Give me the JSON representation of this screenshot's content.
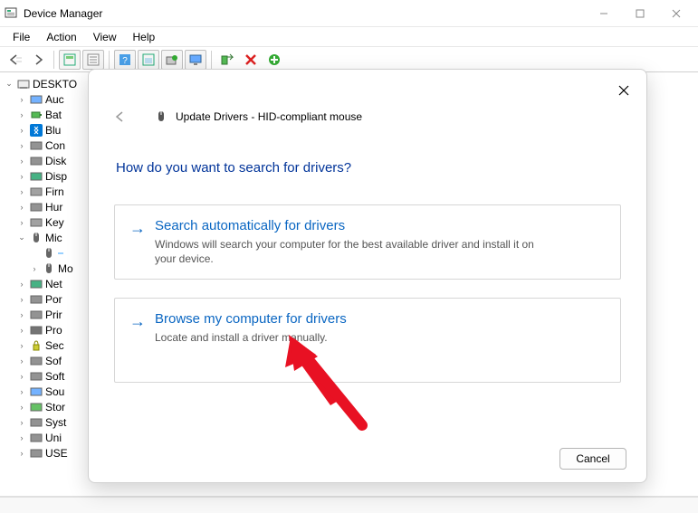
{
  "title": "Device Manager",
  "menus": [
    "File",
    "Action",
    "View",
    "Help"
  ],
  "tree": {
    "root": "DESKTO",
    "items": [
      {
        "label": "Auc"
      },
      {
        "label": "Bat"
      },
      {
        "label": "Blu"
      },
      {
        "label": "Con"
      },
      {
        "label": "Disk"
      },
      {
        "label": "Disp"
      },
      {
        "label": "Firn"
      },
      {
        "label": "Hur"
      },
      {
        "label": "Key"
      },
      {
        "label": "Mic",
        "expanded": true,
        "children": [
          {
            "label": "",
            "selected": true
          },
          {
            "label": "Mo"
          }
        ]
      },
      {
        "label": "Net"
      },
      {
        "label": "Por"
      },
      {
        "label": "Prir"
      },
      {
        "label": "Pro"
      },
      {
        "label": "Sec"
      },
      {
        "label": "Sof"
      },
      {
        "label": "Soft"
      },
      {
        "label": "Sou"
      },
      {
        "label": "Stor"
      },
      {
        "label": "Syst"
      },
      {
        "label": "Uni"
      },
      {
        "label": "USE"
      }
    ]
  },
  "dialog": {
    "title": "Update Drivers - HID-compliant mouse",
    "heading": "How do you want to search for drivers?",
    "opt1_title": "Search automatically for drivers",
    "opt1_desc": "Windows will search your computer for the best available driver and install it on your device.",
    "opt2_title": "Browse my computer for drivers",
    "opt2_desc": "Locate and install a driver manually.",
    "cancel": "Cancel"
  }
}
